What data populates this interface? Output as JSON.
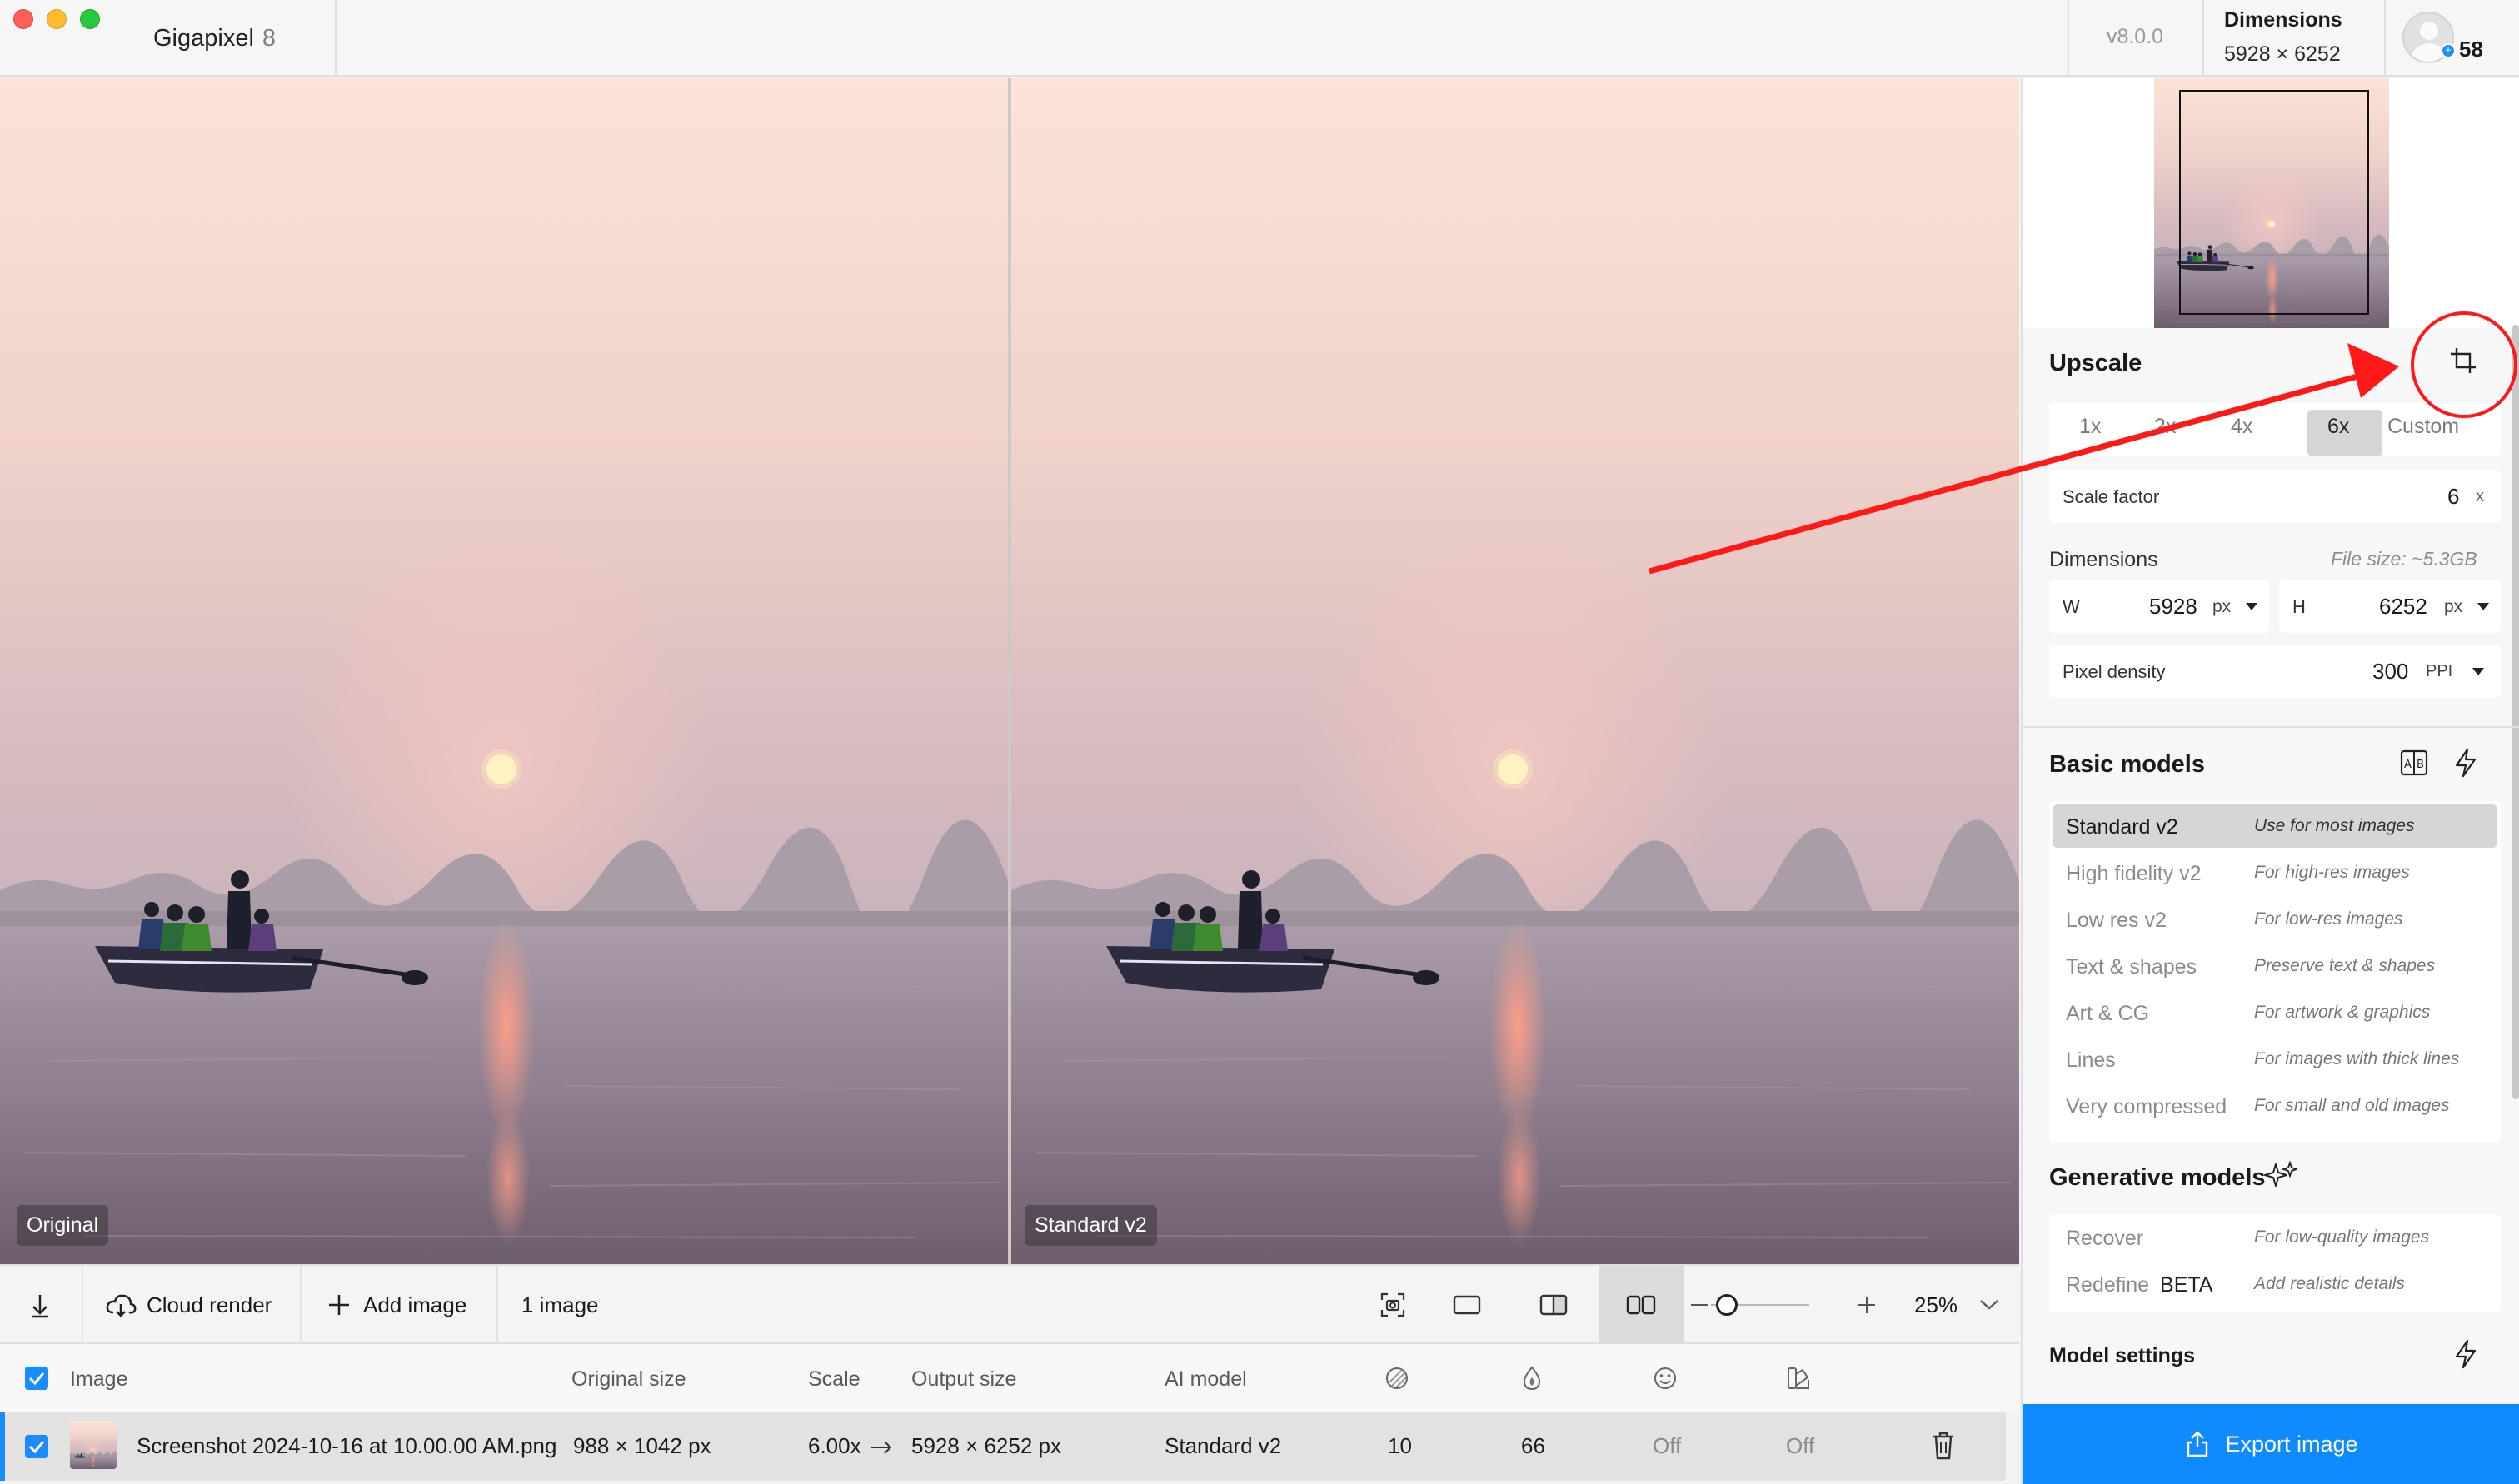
{
  "app": {
    "name": "Gigapixel",
    "major_version": "8",
    "version": "v8.0.0"
  },
  "header": {
    "dimensions_label": "Dimensions",
    "dimensions_value": "5928 × 6252",
    "credits": "58"
  },
  "preview": {
    "left_label": "Original",
    "right_label": "Standard v2"
  },
  "toolbar": {
    "cloud_render": "Cloud render",
    "add_image": "Add image",
    "image_count": "1 image",
    "zoom_value": "25%"
  },
  "table": {
    "headers": {
      "image": "Image",
      "original_size": "Original size",
      "scale": "Scale",
      "output_size": "Output size",
      "ai_model": "AI model"
    },
    "row": {
      "filename": "Screenshot 2024-10-16 at 10.00.00 AM.png",
      "original_size": "988 × 1042 px",
      "scale": "6.00x",
      "output_size": "5928 × 6252 px",
      "ai_model": "Standard v2",
      "denoise": "10",
      "sharpen": "66",
      "face": "Off",
      "color": "Off"
    }
  },
  "panel": {
    "upscale": {
      "title": "Upscale",
      "options": [
        "1x",
        "2x",
        "4x",
        "6x",
        "Custom"
      ],
      "selected": "6x",
      "scale_factor_label": "Scale factor",
      "scale_factor_value": "6",
      "scale_factor_unit": "x"
    },
    "dimensions": {
      "title": "Dimensions",
      "file_size": "File size: ~5.3GB",
      "w_label": "W",
      "w_value": "5928",
      "w_unit": "px",
      "h_label": "H",
      "h_value": "6252",
      "h_unit": "px",
      "density_label": "Pixel density",
      "density_value": "300",
      "density_unit": "PPI"
    },
    "basic_models": {
      "title": "Basic models",
      "items": [
        {
          "name": "Standard v2",
          "desc": "Use for most images"
        },
        {
          "name": "High fidelity v2",
          "desc": "For high-res images"
        },
        {
          "name": "Low res v2",
          "desc": "For low-res images"
        },
        {
          "name": "Text & shapes",
          "desc": "Preserve text & shapes"
        },
        {
          "name": "Art & CG",
          "desc": "For artwork & graphics"
        },
        {
          "name": "Lines",
          "desc": "For images with thick lines"
        },
        {
          "name": "Very compressed",
          "desc": "For small and old images"
        }
      ]
    },
    "generative_models": {
      "title": "Generative models",
      "items": [
        {
          "name": "Recover",
          "desc": "For low-quality images"
        },
        {
          "name": "Redefine",
          "badge": "BETA",
          "desc": "Add realistic details"
        }
      ]
    },
    "model_settings": "Model settings",
    "export": "Export image"
  },
  "colors": {
    "accent": "#108bff",
    "annotation": "#ff1a1a"
  }
}
